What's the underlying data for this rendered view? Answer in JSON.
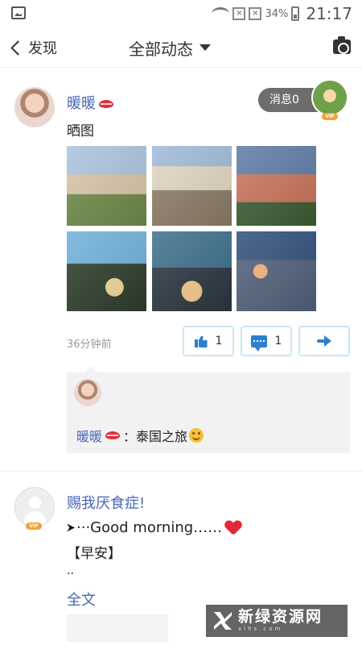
{
  "status_bar": {
    "battery": "34%",
    "time": "21:17"
  },
  "header": {
    "back_label": "发现",
    "title": "全部动态"
  },
  "post1": {
    "username": "暖暖",
    "text": "晒图",
    "message_button": "消息0",
    "time": "36分钟前",
    "likes": "1",
    "comments": "1",
    "comment": {
      "username": "暖暖",
      "colon": "：",
      "text": "泰国之旅"
    }
  },
  "post2": {
    "username": "赐我厌食症!",
    "line1_prefix": "···",
    "line1_text": "Good morning……",
    "line2": "【早安】",
    "line3": "..",
    "full_text_link": "全文"
  },
  "badges": {
    "vip": "VIP"
  },
  "watermark": {
    "cn": "新绿资源网",
    "en": "xlhs.com"
  },
  "colors": {
    "accent_blue": "#2d7fd3",
    "username_blue": "#4a66b5",
    "message_gray": "#6d6d6d",
    "vip_orange": "#f0a23a"
  }
}
